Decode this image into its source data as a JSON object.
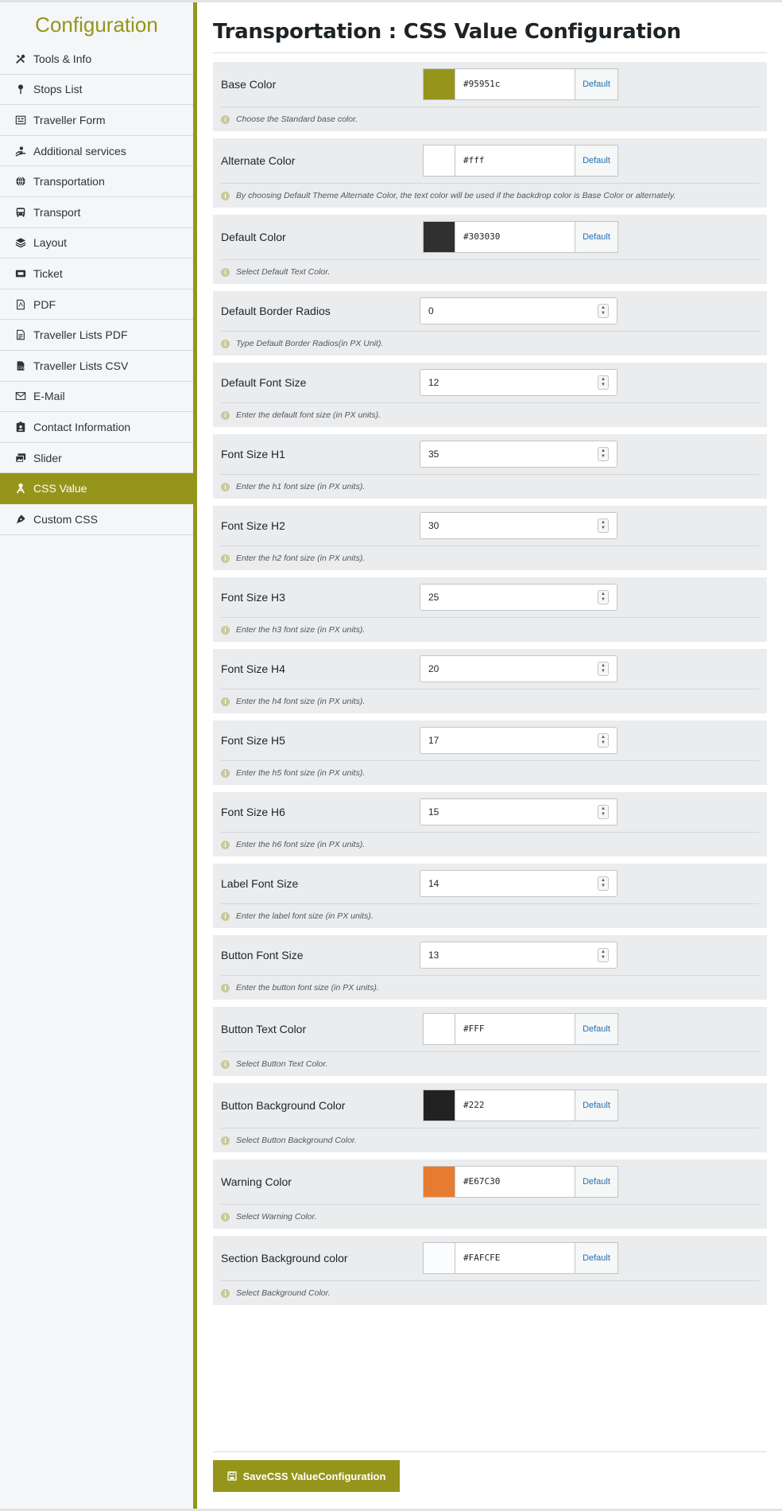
{
  "sidebar": {
    "title": "Configuration",
    "items": [
      {
        "label": "Tools & Info",
        "icon": "tools-icon",
        "active": false
      },
      {
        "label": "Stops List",
        "icon": "pin-icon",
        "active": false
      },
      {
        "label": "Traveller Form",
        "icon": "form-icon",
        "active": false
      },
      {
        "label": "Additional services",
        "icon": "hand-service-icon",
        "active": false
      },
      {
        "label": "Transportation",
        "icon": "globe-icon",
        "active": false
      },
      {
        "label": "Transport",
        "icon": "bus-icon",
        "active": false
      },
      {
        "label": "Layout",
        "icon": "layers-icon",
        "active": false
      },
      {
        "label": "Ticket",
        "icon": "ticket-icon",
        "active": false
      },
      {
        "label": "PDF",
        "icon": "pdf-file-icon",
        "active": false
      },
      {
        "label": "Traveller Lists PDF",
        "icon": "file-icon",
        "active": false
      },
      {
        "label": "Traveller Lists CSV",
        "icon": "csv-file-icon",
        "active": false
      },
      {
        "label": "E-Mail",
        "icon": "envelope-icon",
        "active": false
      },
      {
        "label": "Contact Information",
        "icon": "contact-card-icon",
        "active": false
      },
      {
        "label": "Slider",
        "icon": "images-icon",
        "active": false
      },
      {
        "label": "CSS Value",
        "icon": "css-value-icon",
        "active": true
      },
      {
        "label": "Custom CSS",
        "icon": "pen-nib-icon",
        "active": false
      }
    ]
  },
  "main": {
    "title": "Transportation : CSS Value Configuration",
    "info_icon": "info-icon",
    "rows": [
      {
        "type": "color",
        "label": "Base Color",
        "value": "#95951c",
        "swatch": "#95951c",
        "default_label": "Default",
        "desc": "Choose the Standard base color."
      },
      {
        "type": "color",
        "label": "Alternate Color",
        "value": "#fff",
        "swatch": "#ffffff",
        "default_label": "Default",
        "desc": "By choosing Default Theme Alternate Color, the text color will be used if the backdrop color is Base Color or alternately."
      },
      {
        "type": "color",
        "label": "Default Color",
        "value": "#303030",
        "swatch": "#303030",
        "default_label": "Default",
        "desc": "Select Default Text Color."
      },
      {
        "type": "number",
        "label": "Default Border Radios",
        "value": "0",
        "desc": "Type Default Border Radios(in PX Unit)."
      },
      {
        "type": "number",
        "label": "Default Font Size",
        "value": "12",
        "desc": "Enter the default font size (in PX units)."
      },
      {
        "type": "number",
        "label": "Font Size H1",
        "value": "35",
        "desc": "Enter the h1 font size (in PX units)."
      },
      {
        "type": "number",
        "label": "Font Size H2",
        "value": "30",
        "desc": "Enter the h2 font size (in PX units)."
      },
      {
        "type": "number",
        "label": "Font Size H3",
        "value": "25",
        "desc": "Enter the h3 font size (in PX units)."
      },
      {
        "type": "number",
        "label": "Font Size H4",
        "value": "20",
        "desc": "Enter the h4 font size (in PX units)."
      },
      {
        "type": "number",
        "label": "Font Size H5",
        "value": "17",
        "desc": "Enter the h5 font size (in PX units)."
      },
      {
        "type": "number",
        "label": "Font Size H6",
        "value": "15",
        "desc": "Enter the h6 font size (in PX units)."
      },
      {
        "type": "number",
        "label": "Label Font Size",
        "value": "14",
        "desc": "Enter the label font size (in PX units)."
      },
      {
        "type": "number",
        "label": "Button Font Size",
        "value": "13",
        "desc": "Enter the button font size (in PX units)."
      },
      {
        "type": "color",
        "label": "Button Text Color",
        "value": "#FFF",
        "swatch": "#ffffff",
        "default_label": "Default",
        "desc": "Select Button Text Color."
      },
      {
        "type": "color",
        "label": "Button Background Color",
        "value": "#222",
        "swatch": "#222222",
        "default_label": "Default",
        "desc": "Select Button Background Color."
      },
      {
        "type": "color",
        "label": "Warning Color",
        "value": "#E67C30",
        "swatch": "#e67c30",
        "default_label": "Default",
        "desc": "Select Warning Color."
      },
      {
        "type": "color",
        "label": "Section Background color",
        "value": "#FAFCFE",
        "swatch": "#fafcfe",
        "default_label": "Default",
        "desc": "Select Background Color."
      }
    ],
    "save_label": "SaveCSS ValueConfiguration",
    "save_icon": "floppy-disk-icon"
  },
  "colors": {
    "accent": "#95951c",
    "row_bg": "#ebeced",
    "link": "#2271b1"
  }
}
